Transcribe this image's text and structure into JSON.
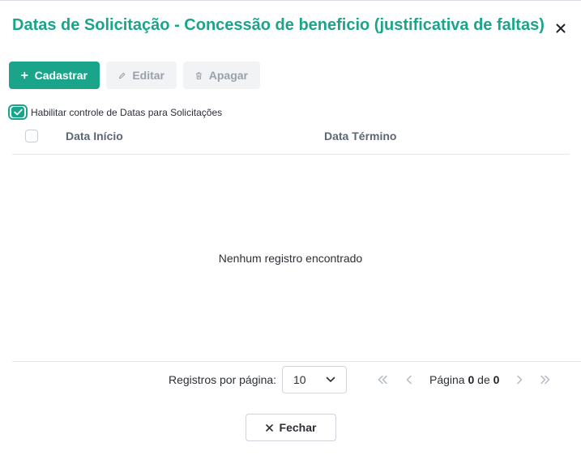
{
  "dialog": {
    "title": "Datas de Solicitação - Concessão de beneficio (justificativa de faltas)"
  },
  "toolbar": {
    "add_label": "Cadastrar",
    "edit_label": "Editar",
    "delete_label": "Apagar"
  },
  "toggle": {
    "label": "Habilitar controle de Datas para Solicitações",
    "checked": true
  },
  "table": {
    "columns": [
      "Data Início",
      "Data Término"
    ],
    "empty_message": "Nenhum registro encontrado"
  },
  "pagination": {
    "per_page_label": "Registros por página:",
    "per_page_value": "10",
    "page_word": "Página",
    "current_page": "0",
    "of_word": "de",
    "total_pages": "0"
  },
  "footer": {
    "close_label": "Fechar"
  },
  "colors": {
    "accent": "#1aa58b",
    "disabled_bg": "#f1f3f5",
    "disabled_text": "#9aa1ab"
  },
  "icons": {
    "close": "close-icon",
    "add": "plus-icon",
    "edit": "pencil-icon",
    "delete": "trash-icon",
    "check": "check-icon",
    "select": "chevron-down-icon",
    "first": "double-chevron-left-icon",
    "prev": "chevron-left-icon",
    "next": "chevron-right-icon",
    "last": "double-chevron-right-icon"
  }
}
